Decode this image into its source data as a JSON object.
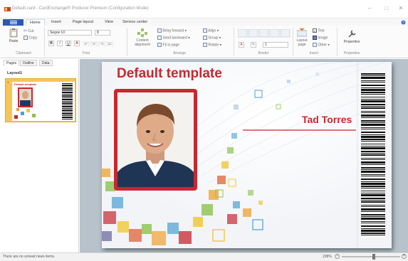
{
  "window": {
    "title": "Default.card - CardExchange® Producer Premium (Configuration Mode)",
    "minimize_glyph": "–",
    "maximize_glyph": "□",
    "close_glyph": "✕"
  },
  "ribbon": {
    "file_label": "",
    "tabs": [
      {
        "label": "Home",
        "active": true
      },
      {
        "label": "Insert"
      },
      {
        "label": "Page layout"
      },
      {
        "label": "View"
      },
      {
        "label": "Service center"
      }
    ],
    "clipboard": {
      "group": "Clipboard",
      "paste": "Paste",
      "cut": "Cut",
      "copy": "Copy"
    },
    "font": {
      "group": "Font",
      "family": "Segoe UI",
      "size": "8",
      "bold": "B",
      "italic": "I",
      "underline": "U",
      "color": "A"
    },
    "arrange": {
      "group": "Arrange",
      "content_alignment": "Content alignment",
      "bring_forward": "Bring forward",
      "send_backward": "Send backward",
      "fit_to_page": "Fit to page",
      "align": "Align",
      "group_btn": "Group",
      "rotate": "Rotate"
    },
    "border": {
      "group": "Border",
      "size_value": "1"
    },
    "insert": {
      "group": "Insert",
      "layout_page": "Layout page",
      "text": "Text",
      "image": "Image",
      "other": "Other"
    },
    "properties": {
      "group": "Properties",
      "label": "Properties"
    }
  },
  "left_panel": {
    "tabs": [
      {
        "label": "Pages",
        "active": true
      },
      {
        "label": "Outline"
      },
      {
        "label": "Data"
      }
    ],
    "layout_label": "Layout1",
    "page_number": "1",
    "thumb_title": "Default template"
  },
  "card": {
    "title": "Default template",
    "name": "Tad Torres",
    "accent": "#c8272f"
  },
  "status": {
    "message": "There are no unread news items.",
    "zoom": "238%",
    "zoom_level": 0.55
  }
}
